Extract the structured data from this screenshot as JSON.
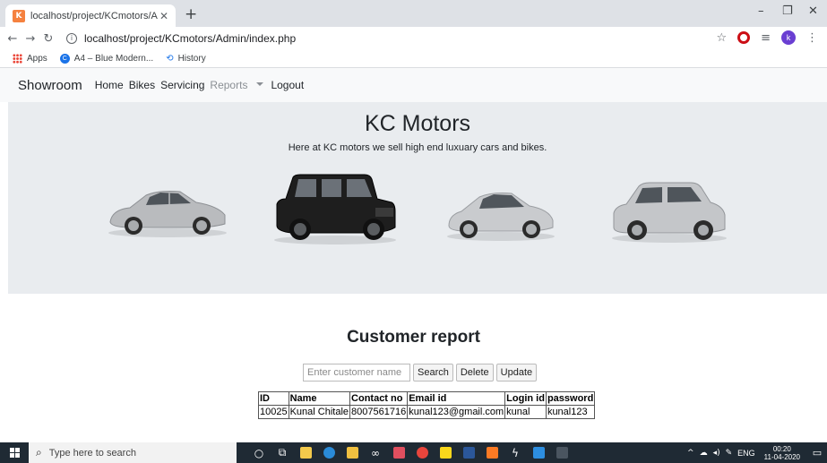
{
  "browser": {
    "tab_title": "localhost/project/KCmotors/Adm",
    "favicon_text": "K",
    "url": "localhost/project/KCmotors/Admin/index.php",
    "bookmarks": [
      {
        "label": "Apps"
      },
      {
        "label": "A4 – Blue Modern..."
      },
      {
        "label": "History"
      }
    ],
    "profile_initial": "k",
    "icons": [
      "back-icon",
      "forward-icon",
      "reload-icon",
      "info-icon",
      "star-icon",
      "opera-icon",
      "extensions-icon",
      "menu-icon"
    ]
  },
  "navbar": {
    "brand": "Showroom",
    "links": [
      "Home",
      "Bikes",
      "Servicing",
      "Reports",
      "Logout"
    ]
  },
  "jumbotron": {
    "title": "KC Motors",
    "subtitle": "Here at KC motors we sell high end luxuary cars and bikes.",
    "cars": [
      {
        "kind": "sedan",
        "color": "#b8babd"
      },
      {
        "kind": "suv-boxy",
        "color": "#1c1c1c"
      },
      {
        "kind": "compact-sedan",
        "color": "#c9cbce"
      },
      {
        "kind": "suv",
        "color": "#c4c6c9"
      }
    ]
  },
  "report": {
    "title": "Customer report",
    "search_placeholder": "Enter customer name",
    "buttons": {
      "search": "Search",
      "delete": "Delete",
      "update": "Update"
    },
    "columns": [
      "ID",
      "Name",
      "Contact no",
      "Email id",
      "Login id",
      "password"
    ],
    "rows": [
      [
        "10025",
        "Kunal Chitale",
        "8007561716",
        "kunal123@gmail.com",
        "kunal",
        "kunal123"
      ]
    ]
  },
  "taskbar": {
    "search_placeholder": "Type here to search",
    "tray_lang": "ENG",
    "time": "00:20",
    "date": "11-04-2020"
  },
  "colors": {
    "navbar_bg": "#f8f9fa",
    "jumbotron_bg": "#e9ecef",
    "taskbar_bg": "#1f2a34",
    "tabstrip_bg": "#dee1e6"
  }
}
